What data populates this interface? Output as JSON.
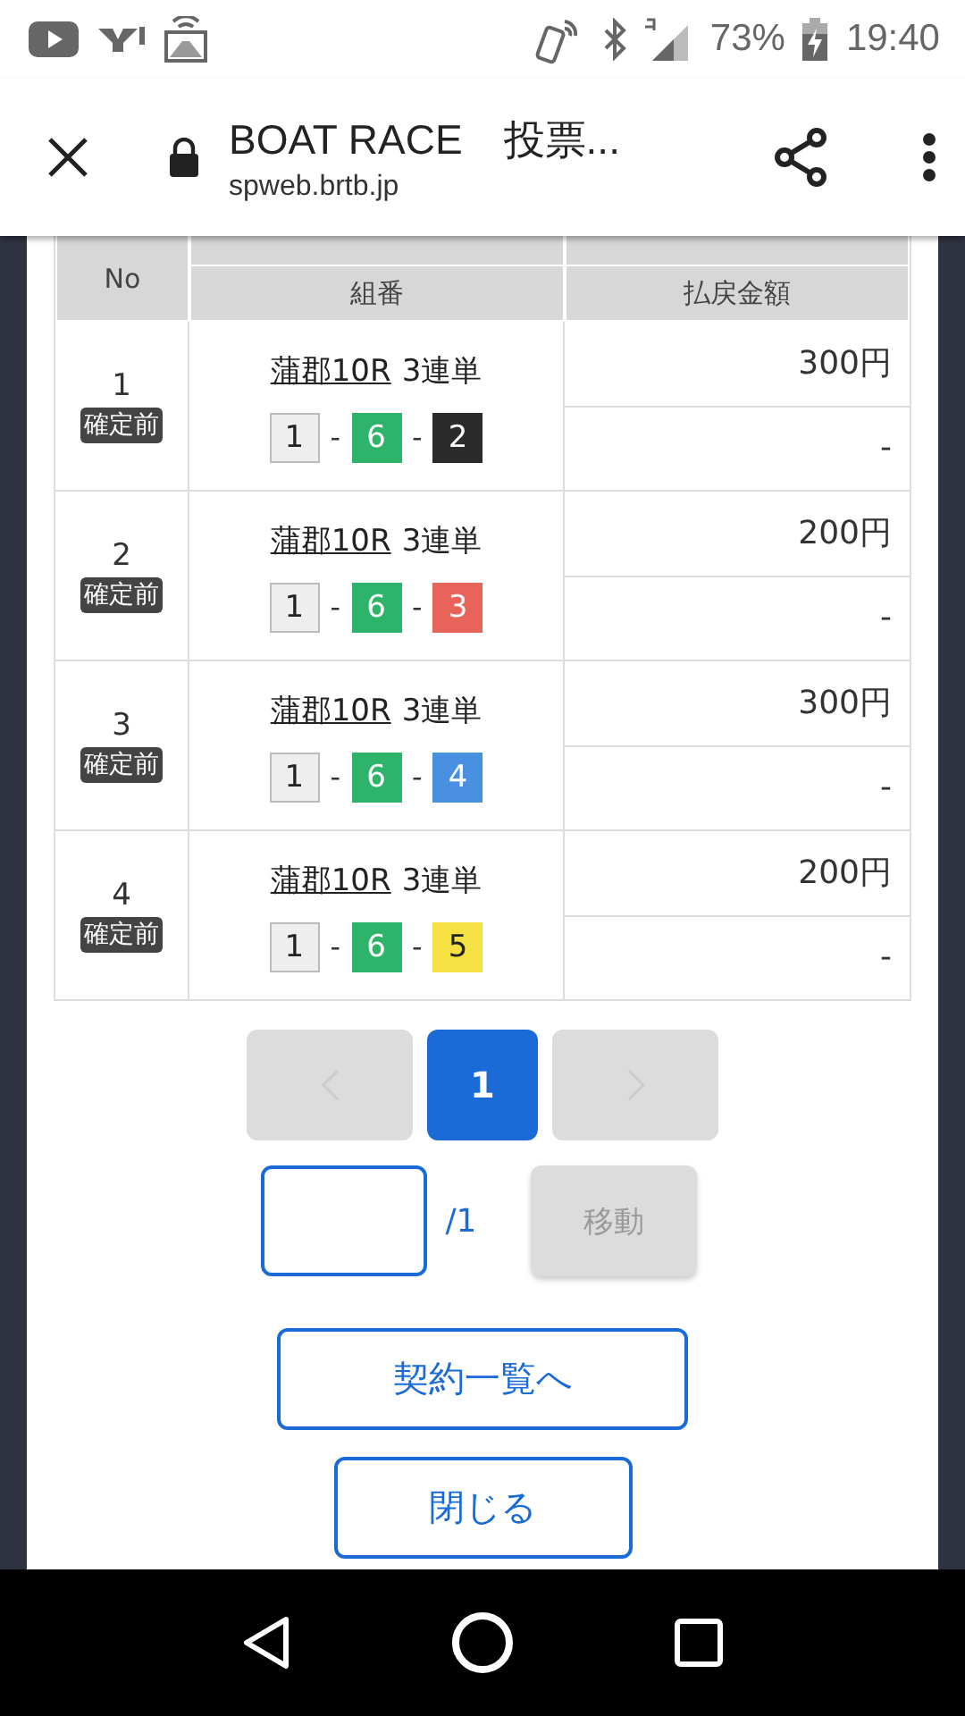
{
  "status_bar": {
    "battery": "73%",
    "time": "19:40"
  },
  "browser": {
    "title": "BOAT RACE　投票...",
    "url": "spweb.brtb.jp"
  },
  "table": {
    "header": {
      "no": "No",
      "combo": "組番",
      "payout": "払戻金額"
    },
    "rows": [
      {
        "no": "1",
        "status": "確定前",
        "race": "蒲郡10R",
        "bet_type": "3連単",
        "balls": [
          {
            "num": "1",
            "color": "#eeeeee"
          },
          {
            "num": "6",
            "color": "#2db36a"
          },
          {
            "num": "2",
            "color": "#2b2b2b"
          }
        ],
        "separator": "-",
        "amount": "300円",
        "payout": "-"
      },
      {
        "no": "2",
        "status": "確定前",
        "race": "蒲郡10R",
        "bet_type": "3連単",
        "balls": [
          {
            "num": "1",
            "color": "#eeeeee"
          },
          {
            "num": "6",
            "color": "#2db36a"
          },
          {
            "num": "3",
            "color": "#e8635a"
          }
        ],
        "separator": "-",
        "amount": "200円",
        "payout": "-"
      },
      {
        "no": "3",
        "status": "確定前",
        "race": "蒲郡10R",
        "bet_type": "3連単",
        "balls": [
          {
            "num": "1",
            "color": "#eeeeee"
          },
          {
            "num": "6",
            "color": "#2db36a"
          },
          {
            "num": "4",
            "color": "#4a90e2"
          }
        ],
        "separator": "-",
        "amount": "300円",
        "payout": "-"
      },
      {
        "no": "4",
        "status": "確定前",
        "race": "蒲郡10R",
        "bet_type": "3連単",
        "balls": [
          {
            "num": "1",
            "color": "#eeeeee"
          },
          {
            "num": "6",
            "color": "#2db36a"
          },
          {
            "num": "5",
            "color": "#f5e142"
          }
        ],
        "separator": "-",
        "amount": "200円",
        "payout": "-"
      }
    ]
  },
  "pagination": {
    "pages": [
      {
        "label": "1",
        "selected": true
      }
    ],
    "total": "/1",
    "move_button": {
      "label": "移動",
      "disabled": true
    }
  },
  "buttons": [
    "契約一覧へ",
    "閉じる"
  ]
}
